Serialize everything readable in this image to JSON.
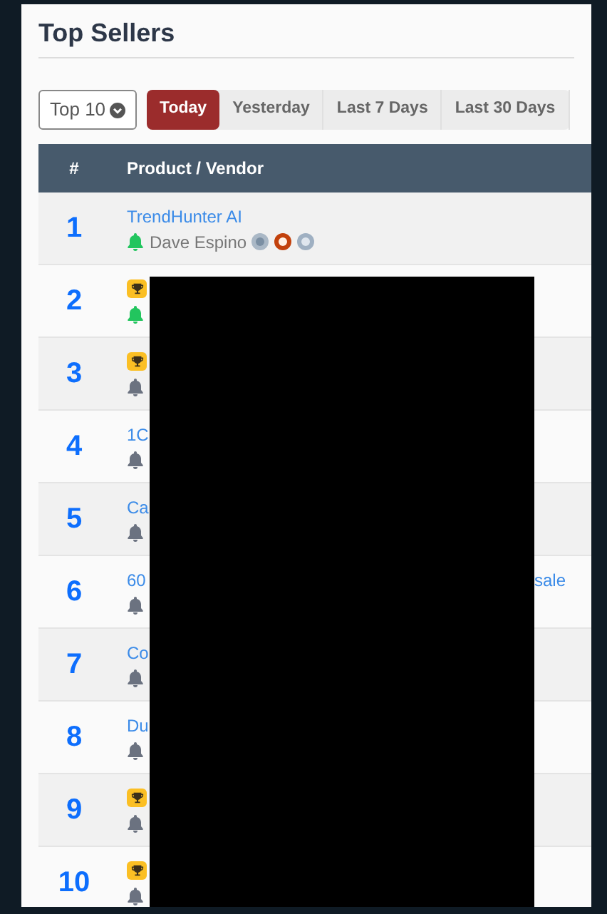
{
  "title": "Top Sellers",
  "limit_select": {
    "value": "Top 10"
  },
  "tabs": [
    {
      "label": "Today",
      "selected": true
    },
    {
      "label": "Yesterday",
      "selected": false
    },
    {
      "label": "Last 7 Days",
      "selected": false
    },
    {
      "label": "Last 30 Days",
      "selected": false
    }
  ],
  "table": {
    "columns": [
      "#",
      "Product / Vendor"
    ],
    "rows": [
      {
        "rank": "1",
        "product": "TrendHunter AI",
        "vendor": "Dave Espino",
        "bell_on": true,
        "trophy": false,
        "vendor_badges": true
      },
      {
        "rank": "2",
        "bell_on": true,
        "trophy": true
      },
      {
        "rank": "3",
        "bell_on": false,
        "trophy": true
      },
      {
        "rank": "4",
        "product": "1C",
        "bell_on": false,
        "trophy": false
      },
      {
        "rank": "5",
        "product": "Ca",
        "bell_on": false,
        "trophy": false
      },
      {
        "rank": "6",
        "product": "60",
        "product_end": "sale",
        "bell_on": false,
        "trophy": false
      },
      {
        "rank": "7",
        "product": "Co",
        "bell_on": false,
        "trophy": false
      },
      {
        "rank": "8",
        "product": "Du",
        "bell_on": false,
        "trophy": false
      },
      {
        "rank": "9",
        "bell_on": false,
        "trophy": true
      },
      {
        "rank": "10",
        "bell_on": false,
        "trophy": true
      }
    ]
  },
  "redacted": true
}
